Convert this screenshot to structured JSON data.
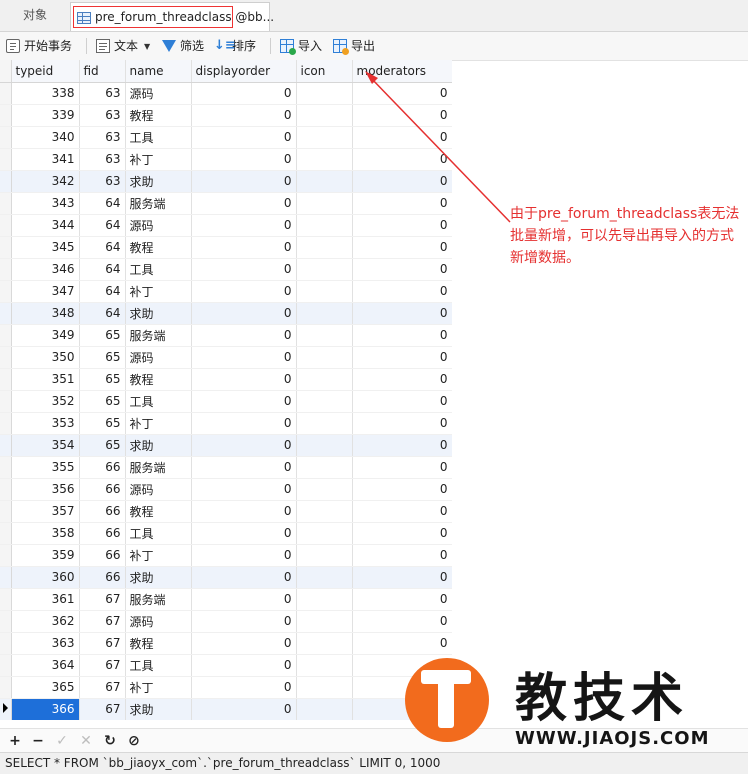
{
  "tabs": {
    "objects": "对象",
    "active": "pre_forum_threadclass @bb..."
  },
  "toolbar": {
    "begin_transaction": "开始事务",
    "text": "文本",
    "filter": "筛选",
    "sort": "排序",
    "import": "导入",
    "export": "导出"
  },
  "grid": {
    "columns": [
      "typeid",
      "fid",
      "name",
      "displayorder",
      "icon",
      "moderators"
    ],
    "rows": [
      [
        "338",
        "63",
        "源码",
        "0",
        "",
        "0"
      ],
      [
        "339",
        "63",
        "教程",
        "0",
        "",
        "0"
      ],
      [
        "340",
        "63",
        "工具",
        "0",
        "",
        "0"
      ],
      [
        "341",
        "63",
        "补丁",
        "0",
        "",
        "0"
      ],
      [
        "342",
        "63",
        "求助",
        "0",
        "",
        "0"
      ],
      [
        "343",
        "64",
        "服务端",
        "0",
        "",
        "0"
      ],
      [
        "344",
        "64",
        "源码",
        "0",
        "",
        "0"
      ],
      [
        "345",
        "64",
        "教程",
        "0",
        "",
        "0"
      ],
      [
        "346",
        "64",
        "工具",
        "0",
        "",
        "0"
      ],
      [
        "347",
        "64",
        "补丁",
        "0",
        "",
        "0"
      ],
      [
        "348",
        "64",
        "求助",
        "0",
        "",
        "0"
      ],
      [
        "349",
        "65",
        "服务端",
        "0",
        "",
        "0"
      ],
      [
        "350",
        "65",
        "源码",
        "0",
        "",
        "0"
      ],
      [
        "351",
        "65",
        "教程",
        "0",
        "",
        "0"
      ],
      [
        "352",
        "65",
        "工具",
        "0",
        "",
        "0"
      ],
      [
        "353",
        "65",
        "补丁",
        "0",
        "",
        "0"
      ],
      [
        "354",
        "65",
        "求助",
        "0",
        "",
        "0"
      ],
      [
        "355",
        "66",
        "服务端",
        "0",
        "",
        "0"
      ],
      [
        "356",
        "66",
        "源码",
        "0",
        "",
        "0"
      ],
      [
        "357",
        "66",
        "教程",
        "0",
        "",
        "0"
      ],
      [
        "358",
        "66",
        "工具",
        "0",
        "",
        "0"
      ],
      [
        "359",
        "66",
        "补丁",
        "0",
        "",
        "0"
      ],
      [
        "360",
        "66",
        "求助",
        "0",
        "",
        "0"
      ],
      [
        "361",
        "67",
        "服务端",
        "0",
        "",
        "0"
      ],
      [
        "362",
        "67",
        "源码",
        "0",
        "",
        "0"
      ],
      [
        "363",
        "67",
        "教程",
        "0",
        "",
        "0"
      ],
      [
        "364",
        "67",
        "工具",
        "0",
        "",
        "0"
      ],
      [
        "365",
        "67",
        "补丁",
        "0",
        "",
        "0"
      ],
      [
        "366",
        "67",
        "求助",
        "0",
        "",
        "0"
      ]
    ],
    "selected_row_index": 28,
    "highlight_color": "#1e6fd9"
  },
  "annotation": {
    "text": "由于pre_forum_threadclass表无法批量新增，可以先导出再导入的方式新增数据。",
    "color": "#e53030"
  },
  "grid_controls": [
    "+",
    "−",
    "✓",
    "✕",
    "↻",
    "⊘"
  ],
  "status": {
    "sql": "SELECT * FROM `bb_jiaoyx_com`.`pre_forum_threadclass` LIMIT 0, 1000"
  },
  "watermark": {
    "title": "教技术",
    "url": "WWW.JIAOJS.COM",
    "logo_color": "#f26b1d"
  }
}
